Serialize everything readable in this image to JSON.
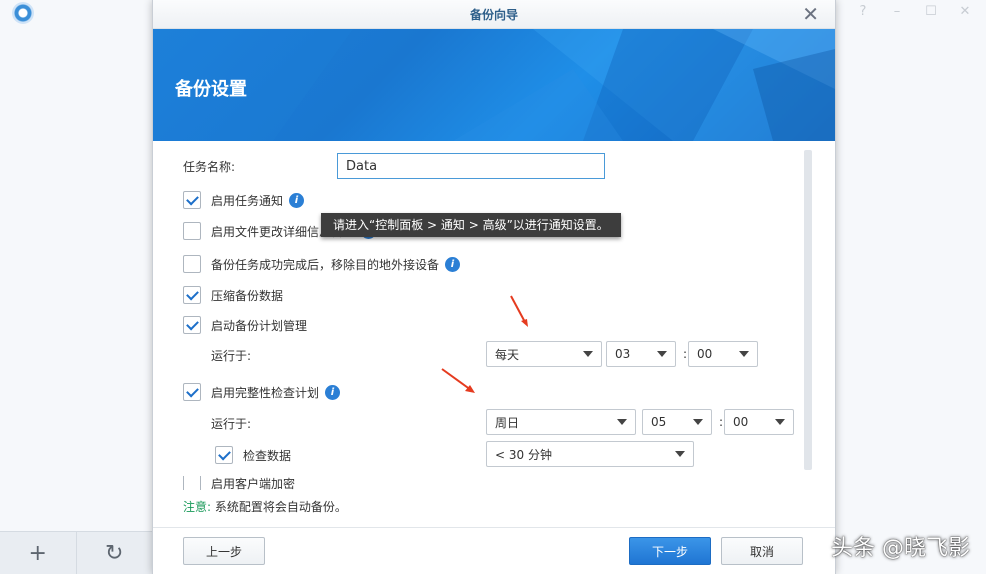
{
  "app": {
    "window_controls": [
      "?",
      "–",
      "☐",
      "✕"
    ]
  },
  "dialog": {
    "title": "备份向导",
    "banner_title": "备份设置",
    "task_name_label": "任务名称:",
    "task_name_value": "Data",
    "options": {
      "enable_notify": {
        "label": "启用任务通知",
        "checked": true
      },
      "file_change_log": {
        "label": "启用文件更改详细信息日志",
        "checked": false
      },
      "remove_device": {
        "label": "备份任务成功完成后，移除目的地外接设备",
        "checked": false
      },
      "compress": {
        "label": "压缩备份数据",
        "checked": true
      },
      "schedule": {
        "label": "启动备份计划管理",
        "checked": true
      },
      "integrity": {
        "label": "启用完整性检查计划",
        "checked": true
      },
      "check_data": {
        "label": "检查数据",
        "checked": true
      },
      "client_encrypt": {
        "label": "启用客户端加密",
        "checked": false
      }
    },
    "schedule_run": {
      "label": "运行于:",
      "day": "每天",
      "hour": "03",
      "minute": "00"
    },
    "integrity_run": {
      "label": "运行于:",
      "day": "周日",
      "hour": "05",
      "minute": "00"
    },
    "check_duration": "< 30 分钟",
    "colon": ":",
    "tooltip": "请进入“控制面板 > 通知 > 高级”以进行通知设置。",
    "note_prefix": "注意:",
    "note_text": " 系统配置将会自动备份。",
    "buttons": {
      "prev": "上一步",
      "next": "下一步",
      "cancel": "取消"
    }
  },
  "bottom_bar": {
    "add_icon": "+",
    "history_icon": "↻"
  },
  "watermark": "头条 @晓飞影",
  "colors": {
    "accent": "#1f75d3",
    "banner": "#1a7ad6",
    "note_warn": "#1a9a5a",
    "arrow": "#e53b1f"
  }
}
